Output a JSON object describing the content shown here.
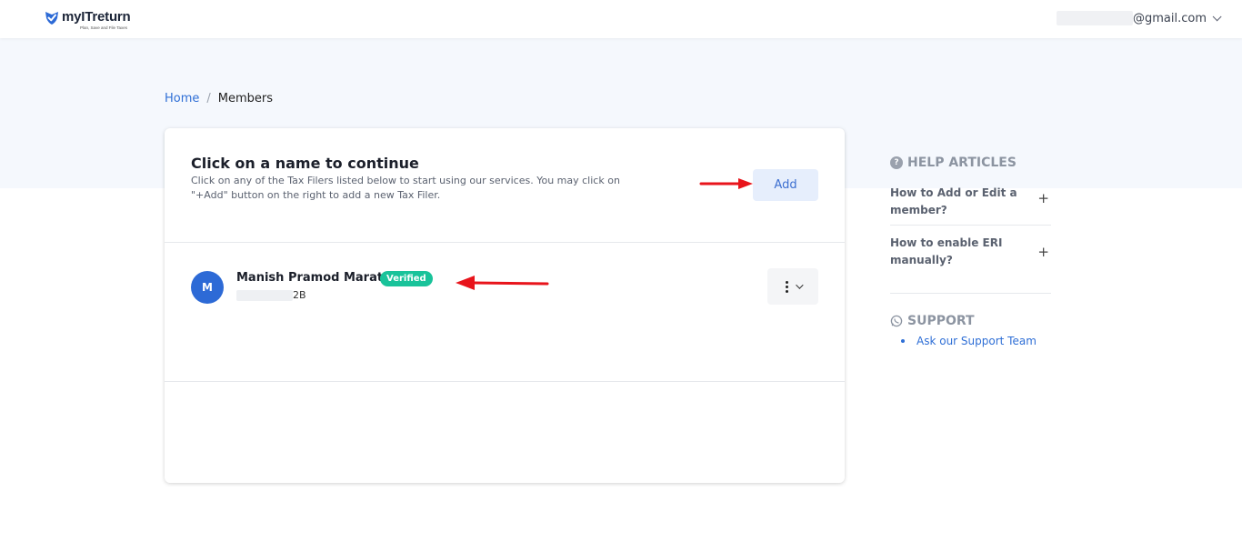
{
  "header": {
    "logo_name": "myITreturn",
    "logo_tagline": "Plan, Save and File Taxes",
    "account_email": "@gmail.com"
  },
  "breadcrumb": {
    "home": "Home",
    "separator": "/",
    "current": "Members"
  },
  "card": {
    "title": "Click on a name to continue",
    "description": "Click on any of the Tax Filers listed below to start using our services. You may click on \"+Add\" button on the right to add a new Tax Filer.",
    "add_label": "Add",
    "member": {
      "initial": "M",
      "name": "Manish Pramod Marathe",
      "badge": "Verified",
      "id_suffix": "2B"
    }
  },
  "help": {
    "title": "HELP ARTICLES",
    "items": [
      {
        "label": "How to Add or Edit a member?"
      },
      {
        "label": "How to enable ERI manually?"
      }
    ]
  },
  "support": {
    "title": "SUPPORT",
    "link": "Ask our Support Team"
  },
  "colors": {
    "accent": "#2f6fd6",
    "verified": "#19c39a",
    "annotation_arrow": "#e8141b"
  }
}
